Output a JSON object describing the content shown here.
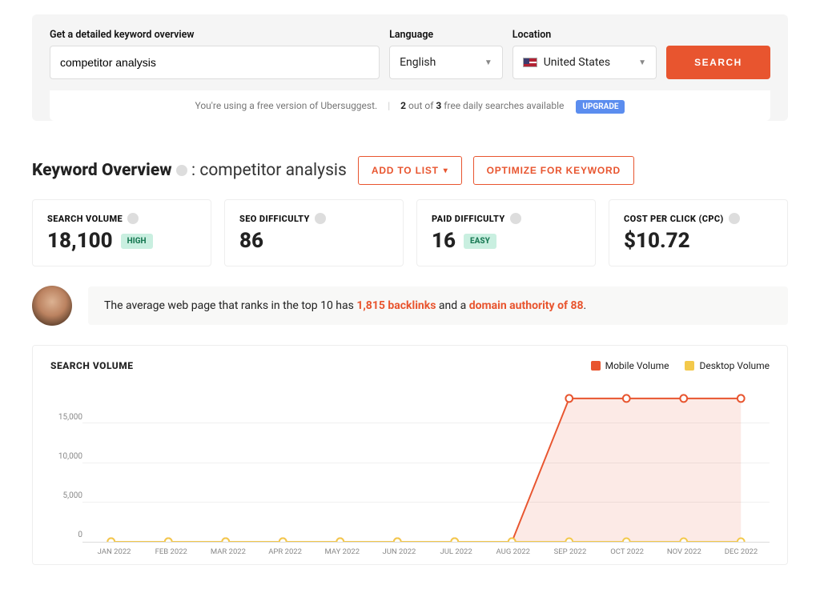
{
  "search": {
    "keyword_label": "Get a detailed keyword overview",
    "keyword_value": "competitor analysis",
    "lang_label": "Language",
    "lang_value": "English",
    "loc_label": "Location",
    "loc_value": "United States",
    "button": "SEARCH"
  },
  "usage": {
    "prefix": "You're using a free version of Ubersuggest.",
    "count_bold1": "2",
    "mid": " out of ",
    "count_bold2": "3",
    "suffix": " free daily searches available",
    "upgrade": "UPGRADE"
  },
  "overview": {
    "heading": "Keyword Overview",
    "colon": ": ",
    "keyword": "competitor analysis",
    "add_to_list": "ADD TO LIST",
    "optimize": "OPTIMIZE FOR KEYWORD"
  },
  "metrics": {
    "search_volume": {
      "label": "SEARCH VOLUME",
      "value": "18,100",
      "badge": "HIGH"
    },
    "seo_diff": {
      "label": "SEO DIFFICULTY",
      "value": "86"
    },
    "paid_diff": {
      "label": "PAID DIFFICULTY",
      "value": "16",
      "badge": "EASY"
    },
    "cpc": {
      "label": "COST PER CLICK (CPC)",
      "value": "$10.72"
    }
  },
  "tip": {
    "pre": "The average web page that ranks in the top 10 has ",
    "hl1": "1,815 backlinks",
    "mid": " and a ",
    "hl2": "domain authority of 88",
    "post": "."
  },
  "chart_data": {
    "type": "line",
    "title": "SEARCH VOLUME",
    "ylabel": "",
    "ylim": [
      0,
      20000
    ],
    "yticks": [
      "15,000",
      "10,000",
      "5,000",
      "0"
    ],
    "categories": [
      "JAN 2022",
      "FEB 2022",
      "MAR 2022",
      "APR 2022",
      "MAY 2022",
      "JUN 2022",
      "JUL 2022",
      "AUG 2022",
      "SEP 2022",
      "OCT 2022",
      "NOV 2022",
      "DEC 2022"
    ],
    "series": [
      {
        "name": "Mobile Volume",
        "color": "#e8552f",
        "values": [
          0,
          0,
          0,
          0,
          0,
          0,
          0,
          0,
          18000,
          18000,
          18000,
          18000
        ]
      },
      {
        "name": "Desktop Volume",
        "color": "#f3c94b",
        "values": [
          0,
          0,
          0,
          0,
          0,
          0,
          0,
          0,
          0,
          0,
          0,
          0
        ]
      }
    ]
  }
}
